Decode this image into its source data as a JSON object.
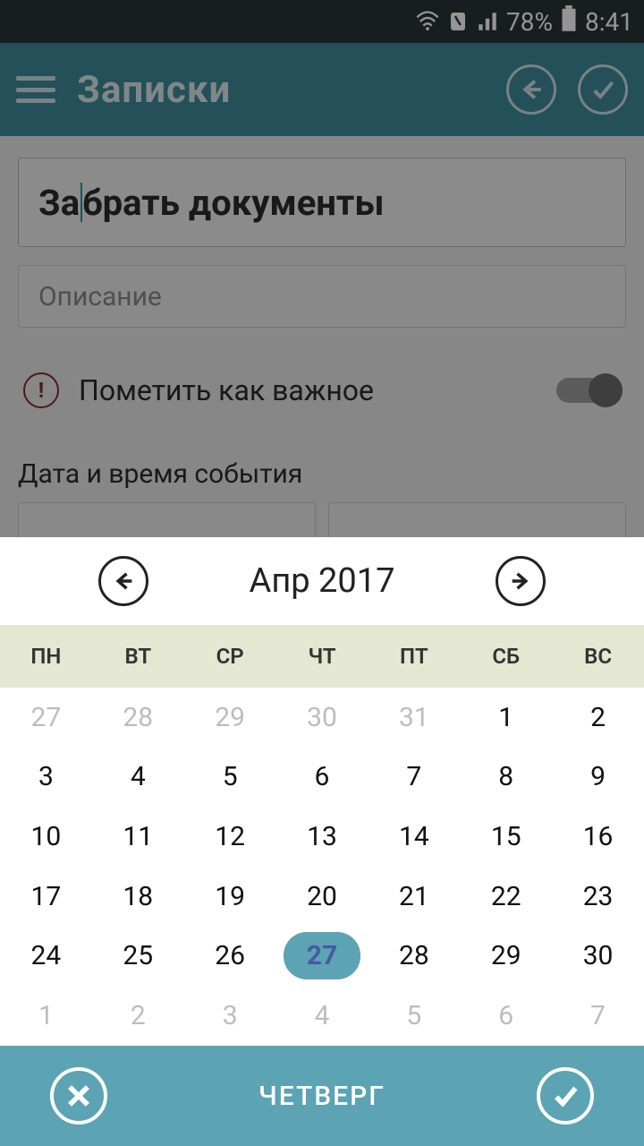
{
  "status": {
    "battery_pct": "78%",
    "time": "8:41"
  },
  "header": {
    "title": "Записки"
  },
  "form": {
    "title_value": "Забрать документы",
    "description_placeholder": "Описание",
    "important_label": "Пометить как важное",
    "datetime_label": "Дата и время события"
  },
  "calendar": {
    "title": "Апр 2017",
    "weekdays": [
      "ПН",
      "ВТ",
      "СР",
      "ЧТ",
      "ПТ",
      "СБ",
      "ВС"
    ],
    "selected": 27,
    "weeks": [
      [
        {
          "d": "27",
          "m": true
        },
        {
          "d": "28",
          "m": true
        },
        {
          "d": "29",
          "m": true
        },
        {
          "d": "30",
          "m": true
        },
        {
          "d": "31",
          "m": true
        },
        {
          "d": "1"
        },
        {
          "d": "2"
        }
      ],
      [
        {
          "d": "3"
        },
        {
          "d": "4"
        },
        {
          "d": "5"
        },
        {
          "d": "6"
        },
        {
          "d": "7"
        },
        {
          "d": "8"
        },
        {
          "d": "9"
        }
      ],
      [
        {
          "d": "10"
        },
        {
          "d": "11"
        },
        {
          "d": "12"
        },
        {
          "d": "13"
        },
        {
          "d": "14"
        },
        {
          "d": "15"
        },
        {
          "d": "16"
        }
      ],
      [
        {
          "d": "17"
        },
        {
          "d": "18"
        },
        {
          "d": "19"
        },
        {
          "d": "20"
        },
        {
          "d": "21"
        },
        {
          "d": "22"
        },
        {
          "d": "23"
        }
      ],
      [
        {
          "d": "24"
        },
        {
          "d": "25"
        },
        {
          "d": "26"
        },
        {
          "d": "27",
          "sel": true
        },
        {
          "d": "28"
        },
        {
          "d": "29"
        },
        {
          "d": "30"
        }
      ],
      [
        {
          "d": "1",
          "m": true
        },
        {
          "d": "2",
          "m": true
        },
        {
          "d": "3",
          "m": true
        },
        {
          "d": "4",
          "m": true
        },
        {
          "d": "5",
          "m": true
        },
        {
          "d": "6",
          "m": true
        },
        {
          "d": "7",
          "m": true
        }
      ]
    ],
    "selected_dayname": "ЧЕТВЕРГ"
  }
}
